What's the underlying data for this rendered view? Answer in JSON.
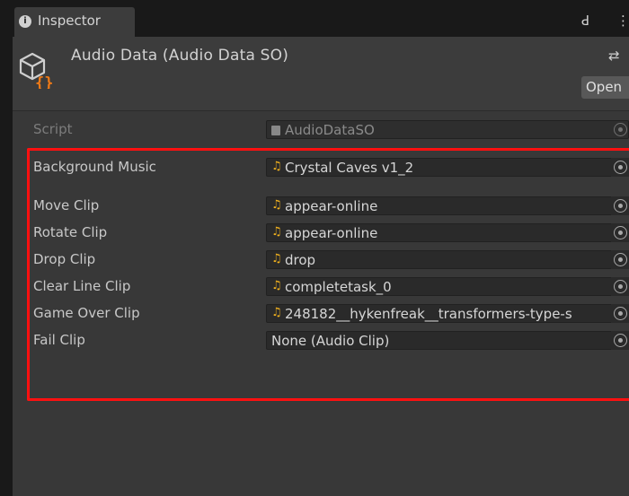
{
  "tab": {
    "label": "Inspector",
    "info_glyph": "i"
  },
  "header": {
    "title": "Audio Data (Audio Data SO)",
    "open_label": "Open",
    "lock_glyph": "ꓒ",
    "kebab_glyph": "⋮",
    "settings_glyph": "⇄"
  },
  "script_row": {
    "label": "Script",
    "value": "AudioDataSO"
  },
  "properties": [
    {
      "label": "Background Music",
      "value": "Crystal Caves v1_2"
    },
    {
      "label": "Move Clip",
      "value": "appear-online"
    },
    {
      "label": "Rotate Clip",
      "value": "appear-online"
    },
    {
      "label": "Drop Clip",
      "value": "drop"
    },
    {
      "label": "Clear Line Clip",
      "value": "completetask_0"
    },
    {
      "label": "Game Over Clip",
      "value": "248182__hykenfreak__transformers-type-s"
    },
    {
      "label": "Fail Clip",
      "value": "None (Audio Clip)"
    }
  ],
  "icons": {
    "audio_clip": "music-note-icon",
    "object_picker": "object-picker-icon",
    "scriptable_object": "scriptable-object-icon"
  },
  "colors": {
    "background": "#383838",
    "field": "#2a2a2a",
    "highlight": "#ff1010",
    "audio_icon": "#f2b21e"
  }
}
